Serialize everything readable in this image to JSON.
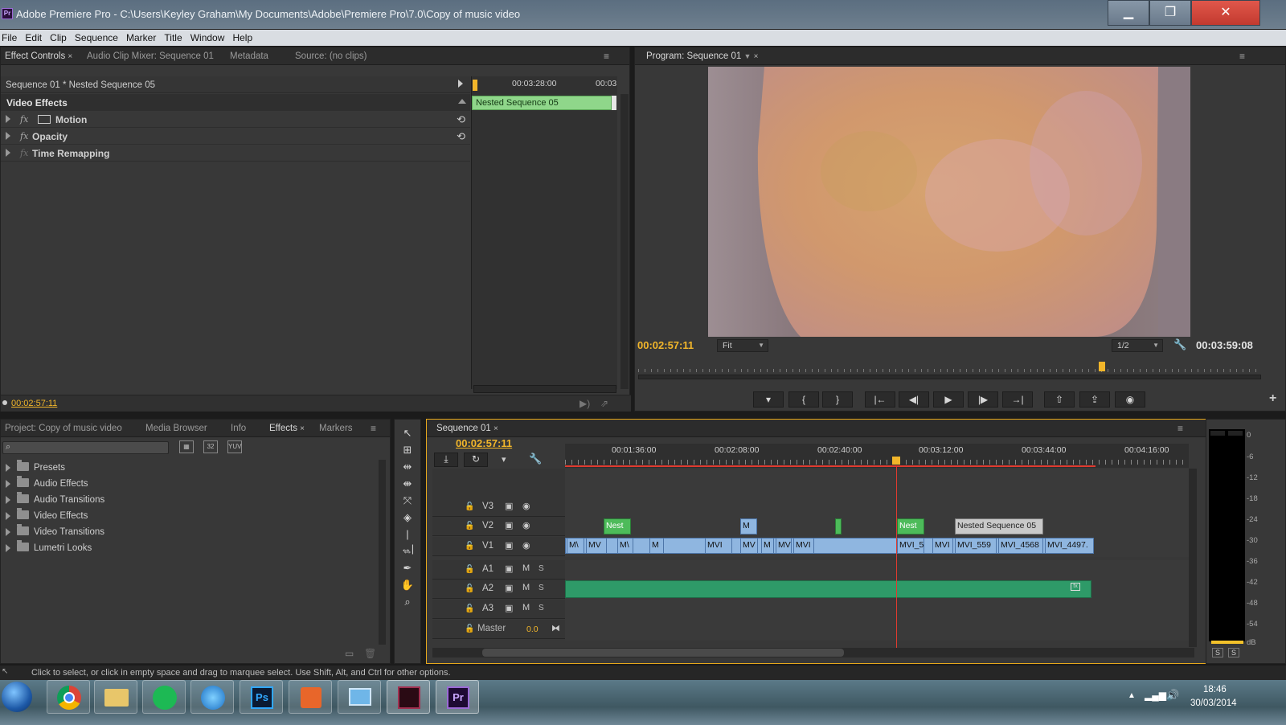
{
  "window": {
    "app_icon": "Pr",
    "title": "Adobe Premiere Pro - C:\\Users\\Keyley Graham\\My Documents\\Adobe\\Premiere Pro\\7.0\\Copy of music video",
    "min_icon": "minimize-icon",
    "max_icon": "maximize-icon",
    "close_icon": "close-icon"
  },
  "menu": [
    "File",
    "Edit",
    "Clip",
    "Sequence",
    "Marker",
    "Title",
    "Window",
    "Help"
  ],
  "effect_controls": {
    "tabs": [
      "Effect Controls",
      "Audio Clip Mixer: Sequence 01",
      "Metadata",
      "Source: (no clips)"
    ],
    "close_glyph": "×",
    "menu_glyph": "≡",
    "breadcrumb": "Sequence 01 * Nested Sequence 05",
    "ruler_time_1": "00:03:28:00",
    "ruler_time_2": "00:03",
    "section": "Video Effects",
    "clip_label": "Nested Sequence 05",
    "fx_glyph": "fx",
    "reset_glyph": "⟲",
    "effects": [
      {
        "name": "Motion"
      },
      {
        "name": "Opacity"
      },
      {
        "name": "Time Remapping"
      }
    ],
    "timecode": "00:02:57:11"
  },
  "program_monitor": {
    "tab": "Program: Sequence 01",
    "current_time": "00:02:57:11",
    "fit": "Fit",
    "resolution": "1/2",
    "duration": "00:03:59:08",
    "controls": [
      {
        "name": "add-marker-button",
        "glyph": "▾"
      },
      {
        "name": "mark-in-button",
        "glyph": "{"
      },
      {
        "name": "mark-out-button",
        "glyph": "}"
      },
      {
        "name": "go-to-in-button",
        "glyph": "|←"
      },
      {
        "name": "step-back-button",
        "glyph": "◀|"
      },
      {
        "name": "play-button",
        "glyph": "▶"
      },
      {
        "name": "step-forward-button",
        "glyph": "|▶"
      },
      {
        "name": "go-to-out-button",
        "glyph": "→|"
      },
      {
        "name": "lift-button",
        "glyph": "⇧"
      },
      {
        "name": "extract-button",
        "glyph": "⇪"
      },
      {
        "name": "export-frame-button",
        "glyph": "◉"
      }
    ],
    "add_glyph": "+"
  },
  "project_panel": {
    "tabs": [
      "Project: Copy of music video",
      "Media Browser",
      "Info",
      "Effects",
      "Markers"
    ],
    "search_placeholder": "",
    "folders": [
      "Presets",
      "Audio Effects",
      "Audio Transitions",
      "Video Effects",
      "Video Transitions",
      "Lumetri Looks"
    ]
  },
  "timeline": {
    "tab": "Sequence 01",
    "timecode": "00:02:57:11",
    "ruler": [
      "00:01:36:00",
      "00:02:08:00",
      "00:02:40:00",
      "00:03:12:00",
      "00:03:44:00",
      "00:04:16:00"
    ],
    "video_tracks": [
      "V3",
      "V2",
      "V1"
    ],
    "audio_tracks": [
      "A1",
      "A2",
      "A3"
    ],
    "master_label": "Master",
    "master_value": "0.0",
    "mute_label": "M",
    "solo_label": "S",
    "v2_clips": [
      "Nest",
      "M",
      "Nest",
      "Nested Sequence 05"
    ],
    "v1_clips": [
      "M\\",
      "MV",
      "M\\",
      "M",
      "MVI",
      "MV",
      "M",
      "MV",
      "MVI",
      "MVI_5",
      "MVI",
      "MVI_559",
      "MVI_4568",
      "MVI_4497."
    ]
  },
  "audio_meter": {
    "labels": [
      "0",
      "-6",
      "-12",
      "-18",
      "-24",
      "-30",
      "-36",
      "-42",
      "-48",
      "-54",
      "dB"
    ],
    "solo_labels": [
      "S",
      "S"
    ]
  },
  "status_bar": "Click to select, or click in empty space and drag to marquee select. Use Shift, Alt, and Ctrl for other options.",
  "taskbar": {
    "time": "18:46",
    "date": "30/03/2014",
    "apps": [
      {
        "name": "start-button-icon"
      },
      {
        "name": "chrome-icon"
      },
      {
        "name": "file-explorer-icon"
      },
      {
        "name": "spotify-icon"
      },
      {
        "name": "itunes-icon"
      },
      {
        "name": "photoshop-icon",
        "label": "Ps"
      },
      {
        "name": "office-icon"
      },
      {
        "name": "control-panel-icon"
      },
      {
        "name": "media-encoder-icon"
      },
      {
        "name": "premiere-icon",
        "label": "Pr"
      }
    ]
  }
}
